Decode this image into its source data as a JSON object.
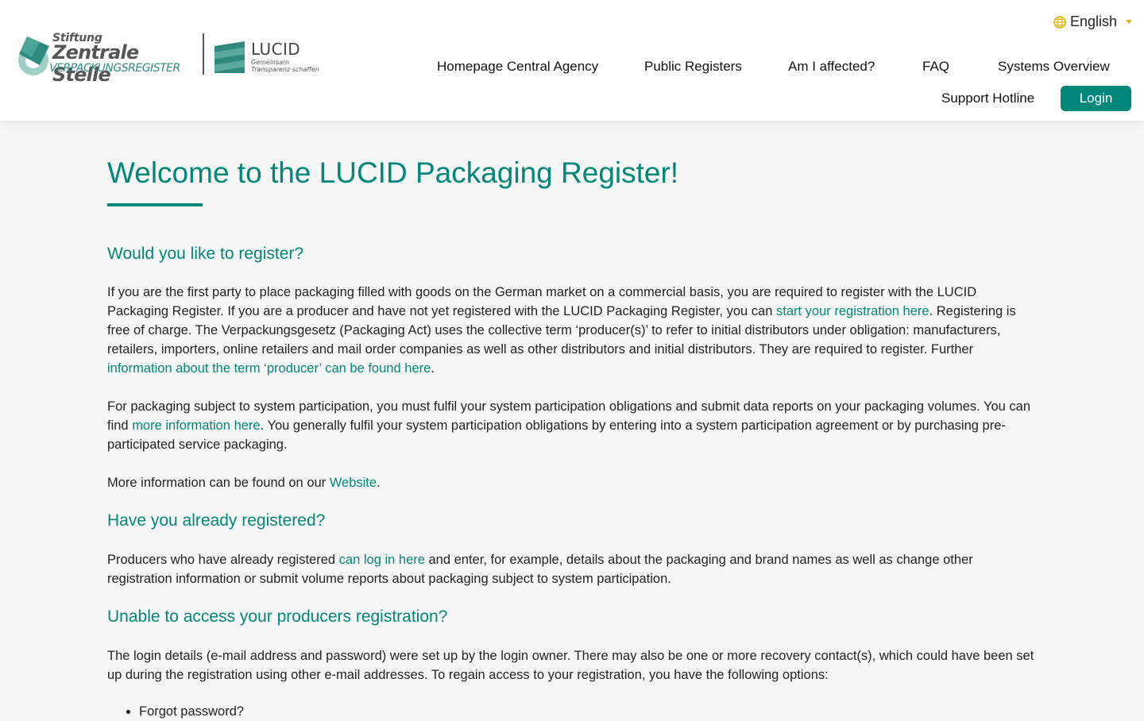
{
  "logo": {
    "stiftung": "Stiftung",
    "zentrale": "Zentrale Stelle",
    "verpackung": "VERPACKUNGSREGISTER",
    "lucid_word": "LUCID",
    "lucid_tag_1": "Gemeinsam",
    "lucid_tag_2": "Transparenz schaffen"
  },
  "language": {
    "label": "English",
    "icon": "globe-icon"
  },
  "nav": {
    "homepage": "Homepage Central Agency",
    "public_registers": "Public Registers",
    "am_i_affected": "Am I affected?",
    "faq": "FAQ",
    "systems_overview": "Systems Overview",
    "support_hotline": "Support Hotline",
    "login": "Login"
  },
  "colors": {
    "accent": "#00877a",
    "language_icon": "#e0b400"
  },
  "content": {
    "title": "Welcome to the LUCID Packaging Register!",
    "register_heading": "Would you like to register?",
    "p1_a": "If you are the first party to place packaging filled with goods on the German market on a commercial basis, you are required to register with the LUCID Packaging Register. If you are a producer and have not yet registered with the LUCID Packaging Register, you can ",
    "p1_link1": "start your registration here",
    "p1_b": ". Registering is free of charge. The Verpackungsgesetz (Packaging Act) uses the collective term ‘producer(s)’ to refer to initial distributors under obligation: manufacturers, retailers, importers, online retailers and mail order companies as well as other distributors and initial distributors. They are required to register. Further ",
    "p1_link2": "information about the term ‘producer’ can be found here",
    "p1_c": ".",
    "p2_a": "For packaging subject to system participation, you must fulfil your system participation obligations and submit data reports on your packaging volumes. You can find ",
    "p2_link": "more information here",
    "p2_b": ". You generally fulfil your system participation obligations by entering into a system participation agreement or by purchasing pre-participated service packaging.",
    "p3_a": "More information can be found on our ",
    "p3_link": "Website",
    "p3_b": ".",
    "registered_heading": "Have you already registered?",
    "p4_a": "Producers who have already registered ",
    "p4_link": "can log in here",
    "p4_b": " and enter, for example, details about the packaging and brand names as well as change other registration information or submit volume reports about packaging subject to system participation.",
    "unable_heading": "Unable to access your producers registration?",
    "p5": "The login details (e-mail address and password) were set up by the login owner. There may also be one or more recovery contact(s), which could have been set up during the registration using other e-mail addresses. To regain access to your registration, you have the following options:",
    "option_1": "Forgot password?"
  }
}
